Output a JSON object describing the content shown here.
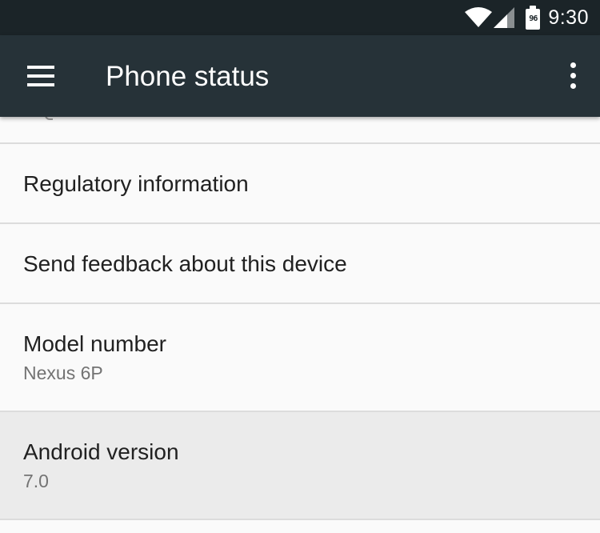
{
  "status_bar": {
    "battery_level": "96",
    "time": "9:30"
  },
  "app_bar": {
    "title": "Phone status",
    "left_icon": "menu-icon",
    "right_icon": "more-vert-icon"
  },
  "colors": {
    "status_bar": "#1b2428",
    "app_bar": "#263238",
    "background": "#fafafa",
    "pressed_item": "#ebebeb",
    "divider": "#dcdcdc",
    "primary_text": "#212121",
    "secondary_text": "#737373"
  },
  "list": {
    "items": [
      {
        "title": "Regulatory information"
      },
      {
        "title": "Send feedback about this device"
      },
      {
        "title": "Model number",
        "summary": "Nexus 6P"
      },
      {
        "title": "Android version",
        "summary": "7.0"
      }
    ]
  }
}
